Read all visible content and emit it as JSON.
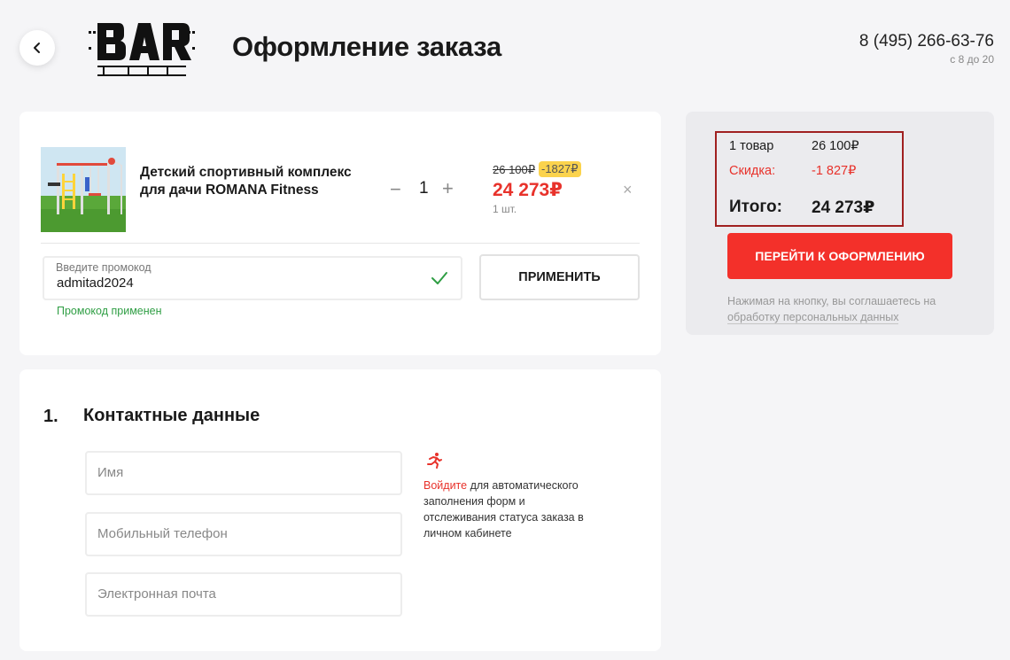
{
  "header": {
    "title": "Оформление заказа",
    "phone": "8 (495) 266-63-76",
    "hours": "с 8 до 20",
    "logo": "BAR FITS"
  },
  "cart": {
    "product_name": "Детский спортивный комплекс для дачи ROMANA Fitness",
    "quantity": "1",
    "qty_minus": "−",
    "qty_plus": "+",
    "old_price": "26 100₽",
    "discount_badge": "-1827₽",
    "new_price": "24 273₽",
    "unit_qty": "1 шт.",
    "remove": "×"
  },
  "promo": {
    "label": "Введите промокод",
    "value": "admitad2024",
    "status": "Промокод применен",
    "apply_label": "ПРИМЕНИТЬ"
  },
  "contacts": {
    "number": "1.",
    "title": "Контактные данные",
    "name_placeholder": "Имя",
    "phone_placeholder": "Мобильный телефон",
    "email_placeholder": "Электронная почта",
    "login_link": "Войдите",
    "login_hint": " для автоматического заполнения форм и отслеживания статуса заказа в личном кабинете"
  },
  "summary": {
    "items_label": "1 товар",
    "items_value": "26 100₽",
    "discount_label": "Скидка:",
    "discount_value": "-1 827₽",
    "total_label": "Итого:",
    "total_value": "24 273₽",
    "checkout_label": "ПЕРЕЙТИ К ОФОРМЛЕНИЮ",
    "consent_text": "Нажимая на кнопку, вы соглашаетесь на ",
    "consent_link": "обработку персональных данных"
  },
  "colors": {
    "accent_red": "#f3302a",
    "success_green": "#2f9e44",
    "badge_yellow": "#fbd34d"
  }
}
